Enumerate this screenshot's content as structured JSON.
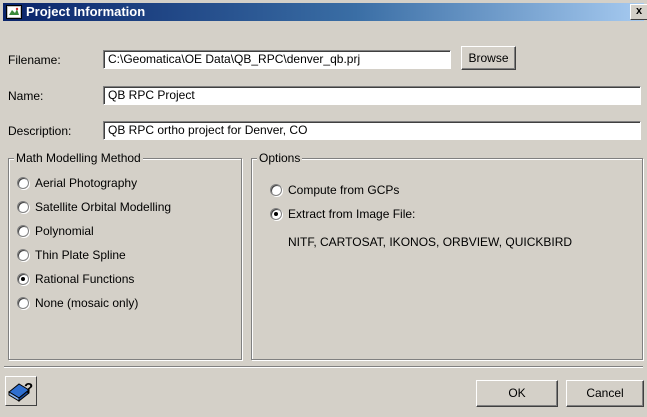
{
  "window": {
    "title": "Project Information",
    "close_label": "x"
  },
  "form": {
    "filename_label": "Filename:",
    "filename_value": "C:\\Geomatica\\OE Data\\QB_RPC\\denver_qb.prj",
    "browse_label": "Browse",
    "name_label": "Name:",
    "name_value": "QB RPC Project",
    "description_label": "Description:",
    "description_value": "QB RPC ortho project for Denver, CO"
  },
  "math_group": {
    "legend": "Math Modelling Method",
    "options": [
      {
        "label": "Aerial Photography",
        "selected": false
      },
      {
        "label": "Satellite Orbital Modelling",
        "selected": false
      },
      {
        "label": "Polynomial",
        "selected": false
      },
      {
        "label": "Thin Plate Spline",
        "selected": false
      },
      {
        "label": "Rational Functions",
        "selected": true
      },
      {
        "label": "None (mosaic only)",
        "selected": false
      }
    ]
  },
  "options_group": {
    "legend": "Options",
    "options": [
      {
        "label": "Compute from GCPs",
        "selected": false
      },
      {
        "label": "Extract from Image File:",
        "selected": true
      }
    ],
    "sensors_text": "NITF, CARTOSAT, IKONOS, ORBVIEW, QUICKBIRD"
  },
  "footer": {
    "help_icon": "help-book-icon",
    "ok_label": "OK",
    "cancel_label": "Cancel"
  }
}
